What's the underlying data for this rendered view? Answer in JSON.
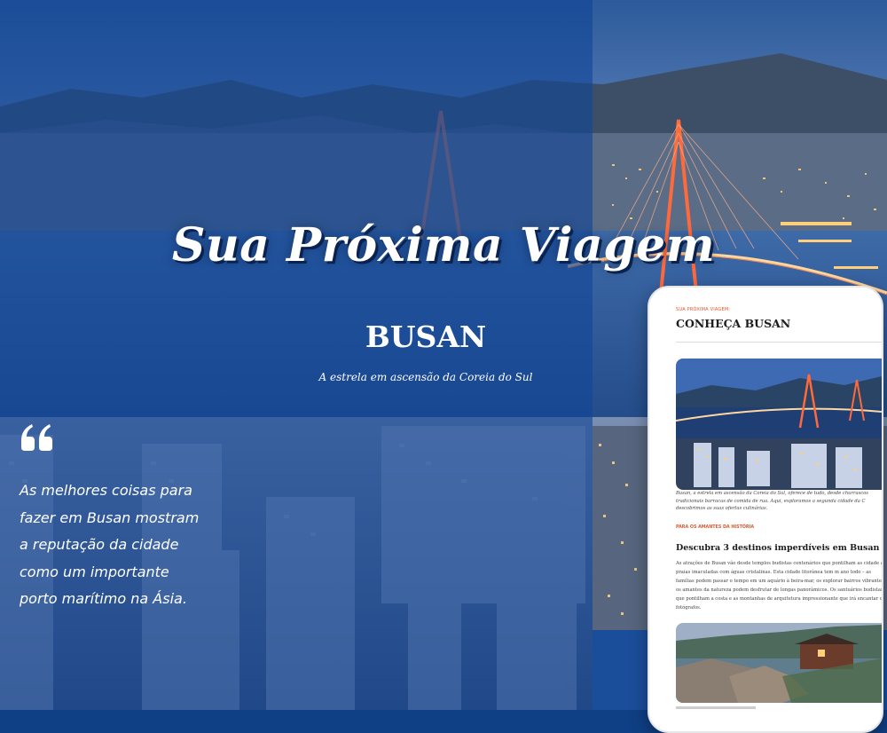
{
  "hero": {
    "headline": "Sua Próxima Viagem",
    "city": "BUSAN",
    "tagline": "A estrela em ascensão da Coreia do Sul"
  },
  "quote": {
    "icon": "quote-open-icon",
    "text": "As melhores coisas para fazer em Busan mostram a reputação da cidade como um importante porto marítimo na Ásia."
  },
  "phone": {
    "kicker": "SUA PRÓXIMA VIAGEM:",
    "title": "CONHEÇA BUSAN",
    "caption": "Busan, a estrela em ascensão da Coreia do Sul, oferece de tudo, desde churrascos tradicionais barracas de comida de rua. Aqui, exploramos a segunda cidade da C descobrimos as suas ofertas culinárias.",
    "section_label": "PARA OS AMANTES DA HISTÓRIA",
    "section_title": "Descubra 3 destinos imperdíveis em Busan",
    "body": "As atrações de Busan vão desde templos budistas centenários que pontilham as cidade até praias imaculadas com águas cristalinas. Esta cidade litorânea tem m ano todo – as famílias podem passar o tempo em um aquário à beira-mar, os explorar bairros vibrantes e os amantes da natureza podem desfrutar de longas panorâmicos. Os santuários budistas que pontilham a costa e as montanhas de arquitetura impressionante que irá encantar os fotógrafos."
  },
  "colors": {
    "overlay": "#1246a0",
    "accent": "#e0572d",
    "text_light": "#ffffff",
    "bridge_light": "#ff6a3d"
  }
}
